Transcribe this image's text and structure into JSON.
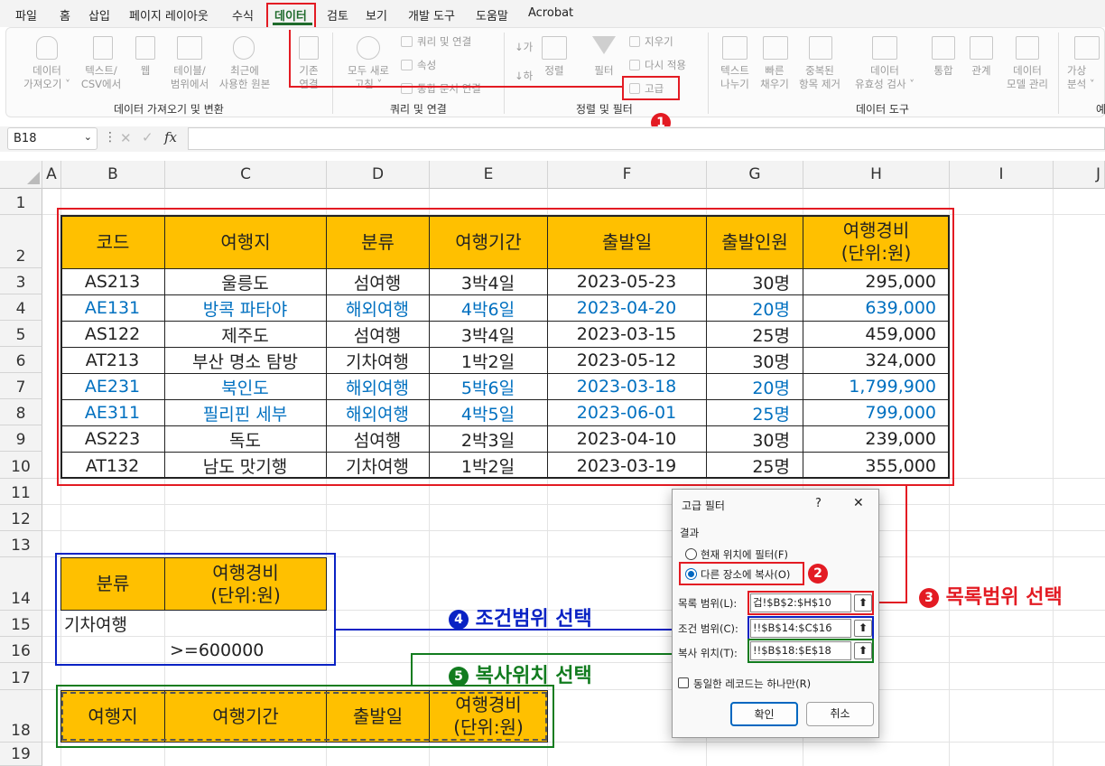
{
  "menu": {
    "items": [
      "파일",
      "홈",
      "삽입",
      "페이지 레이아웃",
      "수식",
      "데이터",
      "검토",
      "보기",
      "개발 도구",
      "도움말",
      "Acrobat"
    ],
    "active": "데이터"
  },
  "ribbon": {
    "get_data": "데이터\n가져오기 ˅",
    "text_csv": "텍스트/\nCSV에서",
    "web": "웹",
    "table_range": "테이블/\n범위에서",
    "recent": "최근에\n사용한 원본",
    "existing": "기존\n연결",
    "refresh_all": "모두 새로\n고침 ˅",
    "queries": "쿼리 및 연결",
    "properties": "속성",
    "edit_links": "통합 문서 연결",
    "sort_az": "↓가",
    "sort_za": "↓하",
    "sort": "정렬",
    "filter": "필터",
    "clear": "지우기",
    "reapply": "다시 적용",
    "advanced": "고급",
    "text_to_col": "텍스트\n나누기",
    "flash_fill": "빠른\n채우기",
    "remove_dup": "중복된\n항목 제거",
    "validation": "데이터\n유효성 검사 ˅",
    "consolidate": "통합",
    "relations": "관계",
    "data_model": "데이터\n모델 관리",
    "whatif": "가상\n분석 ˅",
    "groups": [
      "데이터 가져오기 및 변환",
      "쿼리 및 연결",
      "정렬 및 필터",
      "데이터 도구",
      "예"
    ]
  },
  "formula_bar": {
    "name_box": "B18",
    "fx": "fx",
    "formula": ""
  },
  "columns": [
    "A",
    "B",
    "C",
    "D",
    "E",
    "F",
    "G",
    "H",
    "I",
    "J"
  ],
  "rows": [
    "1",
    "2",
    "3",
    "4",
    "5",
    "6",
    "7",
    "8",
    "9",
    "10",
    "11",
    "12",
    "13",
    "14",
    "15",
    "16",
    "17",
    "18",
    "19"
  ],
  "table": {
    "headers": [
      "코드",
      "여행지",
      "분류",
      "여행기간",
      "출발일",
      "출발인원",
      "여행경비\n(단위:원)"
    ],
    "rows": [
      {
        "code": "AS213",
        "dest": "울릉도",
        "type": "섬여행",
        "period": "3박4일",
        "date": "2023-05-23",
        "people": "30명",
        "cost": "295,000",
        "highlight": false
      },
      {
        "code": "AE131",
        "dest": "방콕 파타야",
        "type": "해외여행",
        "period": "4박6일",
        "date": "2023-04-20",
        "people": "20명",
        "cost": "639,000",
        "highlight": true
      },
      {
        "code": "AS122",
        "dest": "제주도",
        "type": "섬여행",
        "period": "3박4일",
        "date": "2023-03-15",
        "people": "25명",
        "cost": "459,000",
        "highlight": false
      },
      {
        "code": "AT213",
        "dest": "부산 명소 탐방",
        "type": "기차여행",
        "period": "1박2일",
        "date": "2023-05-12",
        "people": "30명",
        "cost": "324,000",
        "highlight": false
      },
      {
        "code": "AE231",
        "dest": "북인도",
        "type": "해외여행",
        "period": "5박6일",
        "date": "2023-03-18",
        "people": "20명",
        "cost": "1,799,900",
        "highlight": true
      },
      {
        "code": "AE311",
        "dest": "필리핀 세부",
        "type": "해외여행",
        "period": "4박5일",
        "date": "2023-06-01",
        "people": "25명",
        "cost": "799,000",
        "highlight": true
      },
      {
        "code": "AS223",
        "dest": "독도",
        "type": "섬여행",
        "period": "2박3일",
        "date": "2023-04-10",
        "people": "30명",
        "cost": "239,000",
        "highlight": false
      },
      {
        "code": "AT132",
        "dest": "남도 맛기행",
        "type": "기차여행",
        "period": "1박2일",
        "date": "2023-03-19",
        "people": "25명",
        "cost": "355,000",
        "highlight": false
      }
    ]
  },
  "criteria": {
    "headers": [
      "분류",
      "여행경비\n(단위:원)"
    ],
    "values": [
      "기차여행",
      ">=600000"
    ]
  },
  "copy_to": {
    "headers": [
      "여행지",
      "여행기간",
      "출발일",
      "여행경비\n(단위:원)"
    ]
  },
  "annotations": {
    "n1": "1",
    "n2": "2",
    "n3": "3",
    "n3_text": "목록범위 선택",
    "n4": "4",
    "n4_text": "조건범위 선택",
    "n5": "5",
    "n5_text": "복사위치 선택"
  },
  "dialog": {
    "title": "고급 필터",
    "help": "?",
    "close": "✕",
    "result_label": "결과",
    "opt_inplace": "현재 위치에 필터(F)",
    "opt_copy": "다른 장소에 복사(O)",
    "list_label": "목록 범위(L):",
    "list_value": "겁!$B$2:$H$10",
    "criteria_label": "조건 범위(C):",
    "criteria_value": "!!$B$14:$C$16",
    "copy_label": "복사 위치(T):",
    "copy_value": "!!$B$18:$E$18",
    "unique_label": "동일한 레코드는 하나만(R)",
    "ok": "확인",
    "cancel": "취소"
  },
  "colors": {
    "red": "#e31b23",
    "blue": "#0a22c4",
    "green": "#127c1f",
    "header_fill": "#ffc000",
    "data_blue": "#0070c0"
  }
}
